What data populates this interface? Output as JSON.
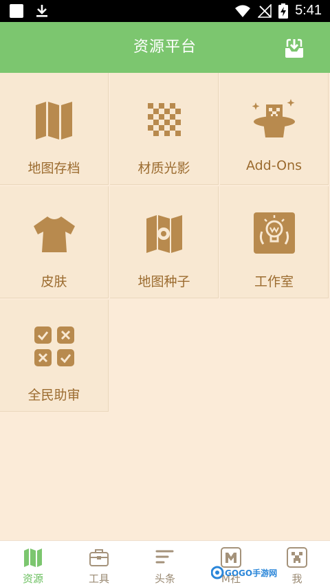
{
  "status_bar": {
    "time": "5:41"
  },
  "header": {
    "title": "资源平台",
    "download_icon": "download-icon"
  },
  "categories": [
    {
      "label": "地图存档",
      "icon": "map-icon"
    },
    {
      "label": "材质光影",
      "icon": "checker-texture-icon"
    },
    {
      "label": "Add-Ons",
      "icon": "magic-hat-icon"
    },
    {
      "label": "皮肤",
      "icon": "shirt-icon"
    },
    {
      "label": "地图种子",
      "icon": "map-seed-icon"
    },
    {
      "label": "工作室",
      "icon": "studio-icon"
    },
    {
      "label": "全民助审",
      "icon": "review-icon"
    }
  ],
  "bottom_nav": [
    {
      "label": "资源",
      "icon": "map-icon",
      "active": true
    },
    {
      "label": "工具",
      "icon": "toolbox-icon",
      "active": false
    },
    {
      "label": "头条",
      "icon": "headlines-icon",
      "active": false
    },
    {
      "label": "M社",
      "icon": "m-community-icon",
      "active": false
    },
    {
      "label": "我",
      "icon": "creeper-face-icon",
      "active": false
    }
  ],
  "watermark": {
    "text": "GOGO手游网"
  },
  "colors": {
    "accent": "#7cc66f",
    "icon_brown": "#b88a4e",
    "label_brown": "#9b6b2f",
    "background": "#fbebd8"
  }
}
